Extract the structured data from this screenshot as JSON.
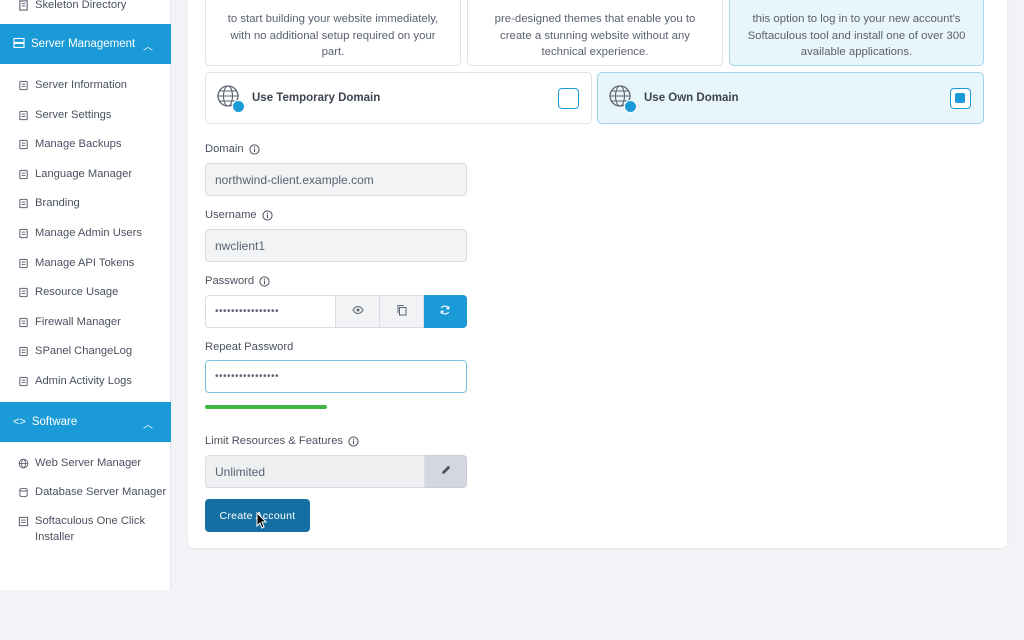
{
  "sidebar": {
    "top_item": "Skeleton Directory",
    "server_section": "Server Management",
    "server_items": [
      {
        "label": "Server Information",
        "icon": "document-icon"
      },
      {
        "label": "Server Settings",
        "icon": "settings-icon"
      },
      {
        "label": "Manage Backups",
        "icon": "history-icon"
      },
      {
        "label": "Language Manager",
        "icon": "translate-icon"
      },
      {
        "label": "Branding",
        "icon": "branding-icon"
      },
      {
        "label": "Manage Admin Users",
        "icon": "admin-user-icon"
      },
      {
        "label": "Manage API Tokens",
        "icon": "api-icon"
      },
      {
        "label": "Resource Usage",
        "icon": "gauge-icon"
      },
      {
        "label": "Firewall Manager",
        "icon": "shield-icon"
      },
      {
        "label": "SPanel ChangeLog",
        "icon": "history-icon"
      },
      {
        "label": "Admin Activity Logs",
        "icon": "log-icon"
      }
    ],
    "software_section": "Software",
    "software_items": [
      {
        "label": "Web Server Manager",
        "icon": "globe-icon"
      },
      {
        "label": "Database Server Manager",
        "icon": "database-icon"
      },
      {
        "label": "Softaculous One Click Installer",
        "icon": "installer-icon"
      }
    ]
  },
  "options": {
    "card1_text": "to start building your website immediately, with no additional setup required on your part.",
    "card2_text": "pre-designed themes that enable you to create a stunning website without any technical experience.",
    "card3_text": "this option to log in to your new account's Softaculous tool and install one of over 300 available applications."
  },
  "domain_choice": {
    "temporary": {
      "label": "Use Temporary Domain",
      "checked": false
    },
    "own": {
      "label": "Use Own Domain",
      "checked": true
    }
  },
  "form": {
    "domain_label": "Domain",
    "domain_value": "northwind-client.example.com",
    "username_label": "Username",
    "username_value": "nwclient1",
    "password_label": "Password",
    "password_value": "••••••••••••••••",
    "repeat_password_label": "Repeat Password",
    "repeat_password_value": "••••••••••••••••",
    "limit_label": "Limit Resources & Features",
    "limit_value": "Unlimited",
    "submit_label": "Create Account"
  },
  "colors": {
    "accent": "#1a9ad6",
    "button": "#166fa3",
    "strength": "#3fb543"
  }
}
